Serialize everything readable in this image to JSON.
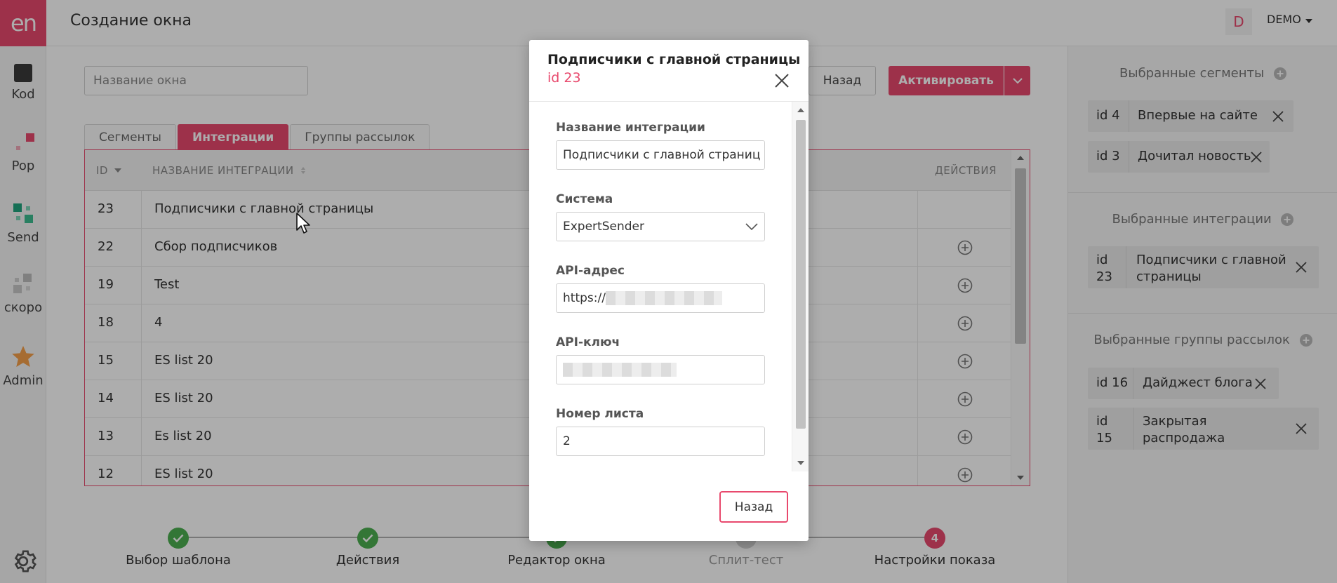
{
  "app": {
    "logo_text": "en",
    "page_title": "Создание окна",
    "user_initial": "D",
    "user_name": "DEMO"
  },
  "nav": [
    {
      "label": "Kod",
      "icon": "code-square-icon"
    },
    {
      "label": "Pop",
      "icon": "pop-icon"
    },
    {
      "label": "Send",
      "icon": "send-grid-icon"
    },
    {
      "label": "скоро",
      "icon": "soon-grid-icon"
    },
    {
      "label": "Admin",
      "icon": "star-icon"
    }
  ],
  "toolbar": {
    "window_name_placeholder": "Название окна",
    "back_label": "Назад",
    "activate_label": "Активировать"
  },
  "tabs": [
    {
      "label": "Сегменты",
      "active": false
    },
    {
      "label": "Интеграции",
      "active": true
    },
    {
      "label": "Группы рассылок",
      "active": false
    }
  ],
  "table": {
    "columns": {
      "id": "ID",
      "name": "НАЗВАНИЕ ИНТЕГРАЦИИ",
      "actions": "ДЕЙСТВИЯ"
    },
    "rows": [
      {
        "id": "23",
        "name": "Подписчики с главной страницы",
        "addable": false
      },
      {
        "id": "22",
        "name": "Сбор подписчиков",
        "addable": true
      },
      {
        "id": "19",
        "name": "Test",
        "addable": true
      },
      {
        "id": "18",
        "name": "4",
        "addable": true
      },
      {
        "id": "15",
        "name": "ES list 20",
        "addable": true
      },
      {
        "id": "14",
        "name": "ES list 20",
        "addable": true
      },
      {
        "id": "13",
        "name": "Es list 20",
        "addable": true
      },
      {
        "id": "12",
        "name": "ES list 20",
        "addable": true
      }
    ]
  },
  "stepper": [
    {
      "label": "Выбор шаблона",
      "state": "done"
    },
    {
      "label": "Действия",
      "state": "done"
    },
    {
      "label": "Редактор окна",
      "state": "done"
    },
    {
      "label": "Сплит-тест",
      "state": "disabled"
    },
    {
      "label": "Настройки показа",
      "state": "current",
      "number": "4"
    }
  ],
  "right_panel": {
    "segments": {
      "title": "Выбранные сегменты",
      "items": [
        {
          "id": "id 4",
          "name": "Впервые на сайте"
        },
        {
          "id": "id 3",
          "name": "Дочитал новость"
        }
      ]
    },
    "integrations": {
      "title": "Выбранные интеграции",
      "items": [
        {
          "id_line1": "id",
          "id_line2": "23",
          "name_line1": "Подписчики с главной",
          "name_line2": "страницы"
        }
      ]
    },
    "groups": {
      "title": "Выбранные группы рассылок",
      "items": [
        {
          "id": "id 16",
          "name": "Дайджест блога"
        },
        {
          "id_line1": "id",
          "id_line2": "15",
          "name_line1": "Закрытая",
          "name_line2": "распродажа"
        }
      ]
    }
  },
  "modal": {
    "title": "Подписчики с главной страницы",
    "subtitle": "id 23",
    "fields": {
      "name_label": "Название интеграции",
      "name_value": "Подписчики с главной страниц",
      "system_label": "Система",
      "system_value": "ExpertSender",
      "api_url_label": "API-адрес",
      "api_url_prefix": "https://",
      "api_key_label": "API-ключ",
      "list_label": "Номер листа",
      "list_value": "2"
    },
    "back_label": "Назад"
  },
  "colors": {
    "accent": "#e8496d",
    "success": "#4caf50",
    "send_teal": "#3dbb8f"
  }
}
